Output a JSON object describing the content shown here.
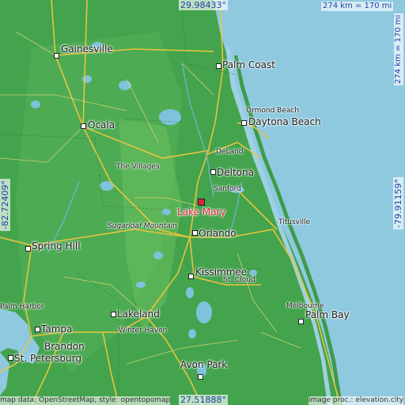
{
  "map": {
    "coords": {
      "top_lat": "29.98433°",
      "bottom_lat": "27.51888°",
      "left_lon": "-82.72409°",
      "right_lon": "-79.91159°"
    },
    "scale": {
      "horizontal": "274 km = 170 mi",
      "vertical": "274 km = 170 mi"
    },
    "featured_place": "Lake Mary",
    "cities": {
      "gainesville": "Gainesville",
      "palm_coast": "Palm Coast",
      "ocala": "Ocala",
      "ormond_beach": "Ormond Beach",
      "daytona_beach": "Daytona Beach",
      "deland": "DeLand",
      "the_villages": "The Villages",
      "deltona": "Deltona",
      "sanford": "Sanford",
      "sugarloaf": "Sugarloaf Mountain",
      "orlando": "Orlando",
      "titusville": "Titusville",
      "spring_hill": "Spring Hill",
      "kissimmee": "Kissimmee",
      "st_cloud": "St. Cloud",
      "palm_harbor": "Palm Harbor",
      "lakeland": "Lakeland",
      "melbourne": "Melbourne",
      "palm_bay": "Palm Bay",
      "tampa": "Tampa",
      "winter_haven": "Winter Haven",
      "brandon": "Brandon",
      "st_petersburg": "St. Petersburg",
      "avon_park": "Avon Park"
    },
    "credits": {
      "left": "map data: OpenStreetMap, style: opentopomap",
      "right": "image proc.: elevation.city"
    },
    "colors": {
      "ocean": "#8fc9df",
      "land_low": "#3f9f4b",
      "land_high": "#5bb85a",
      "road": "#f2c53d",
      "featured": "#e0243a",
      "coord_text": "#1f43a8"
    }
  }
}
